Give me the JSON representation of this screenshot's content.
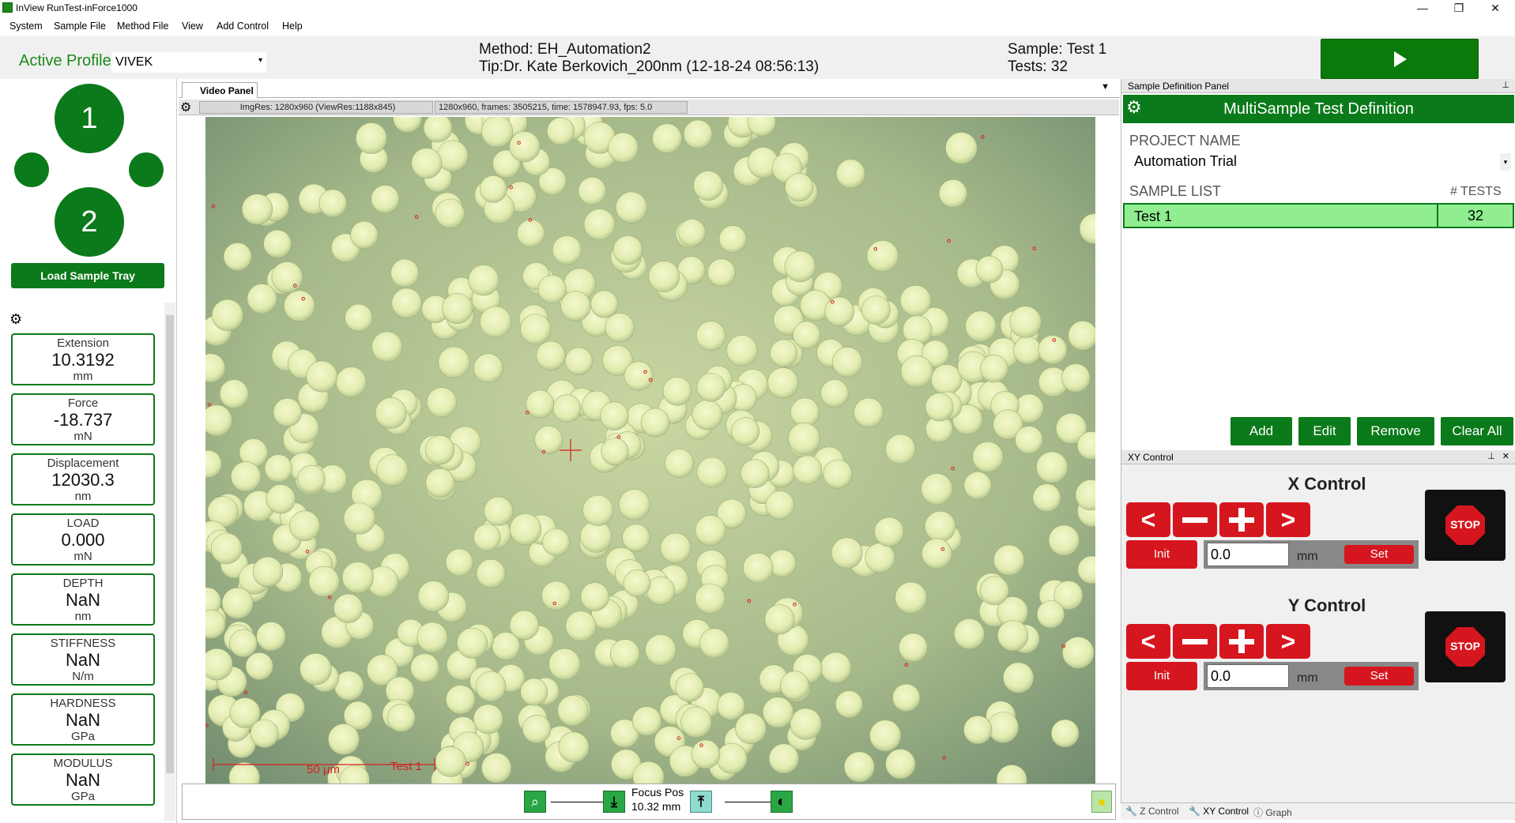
{
  "window": {
    "title": "InView RunTest-inForce1000",
    "controls": [
      "—",
      "❐",
      "✕"
    ]
  },
  "menu": [
    "System",
    "Sample File",
    "Method File",
    "View",
    "Add Control",
    "Help"
  ],
  "header": {
    "active_profile_label": "Active Profile",
    "active_profile_value": "VIVEK",
    "method_line": "Method: EH_Automation2",
    "tip_line": "Tip:Dr. Kate Berkovich_200nm (12-18-24 08:56:13)",
    "sample_line": "Sample: Test 1",
    "tests_line": "Tests: 32"
  },
  "left_panel": {
    "position_1": "1",
    "position_2": "2",
    "load_button": "Load Sample Tray",
    "readouts": [
      {
        "label": "Extension",
        "value": "10.3192",
        "unit": "mm"
      },
      {
        "label": "Force",
        "value": "-18.737",
        "unit": "mN"
      },
      {
        "label": "Displacement",
        "value": "12030.3",
        "unit": "nm"
      },
      {
        "label": "LOAD",
        "value": "0.000",
        "unit": "mN"
      },
      {
        "label": "DEPTH",
        "value": "NaN",
        "unit": "nm"
      },
      {
        "label": "STIFFNESS",
        "value": "NaN",
        "unit": "N/m"
      },
      {
        "label": "HARDNESS",
        "value": "NaN",
        "unit": "GPa"
      },
      {
        "label": "MODULUS",
        "value": "NaN",
        "unit": "GPa"
      }
    ]
  },
  "video_panel": {
    "tab_label": "Video Panel",
    "img_res": "ImgRes: 1280x960 (ViewRes:1188x845)",
    "stream_info": "1280x960, frames: 3505215, time: 1578947.93, fps: 5.0",
    "scale_label": "50 µm",
    "overlay_label": "Test 1",
    "focus_label": "Focus Pos",
    "focus_value": "10.32 mm"
  },
  "sample_definition": {
    "panel_title": "Sample Definition Panel",
    "heading": "MultiSample Test Definition",
    "project_name_label": "PROJECT NAME",
    "project_name_value": "Automation Trial",
    "sample_list_label": "SAMPLE LIST",
    "tests_col_label": "# TESTS",
    "samples": [
      {
        "name": "Test 1",
        "tests": "32"
      }
    ],
    "buttons": {
      "add": "Add",
      "edit": "Edit",
      "remove": "Remove",
      "clear_all": "Clear All"
    }
  },
  "xy_control": {
    "panel_title": "XY Control",
    "x_title": "X Control",
    "y_title": "Y Control",
    "init_label": "Init",
    "set_label": "Set",
    "x_value": "0.0",
    "y_value": "0.0",
    "unit": "mm",
    "stop_label": "STOP"
  },
  "bottom_tabs": [
    "Z Control",
    "XY Control",
    "Graph"
  ],
  "colors": {
    "primary_green": "#0b7a1a",
    "highlight_green": "#90ee90",
    "stop_red": "#d6161f"
  }
}
